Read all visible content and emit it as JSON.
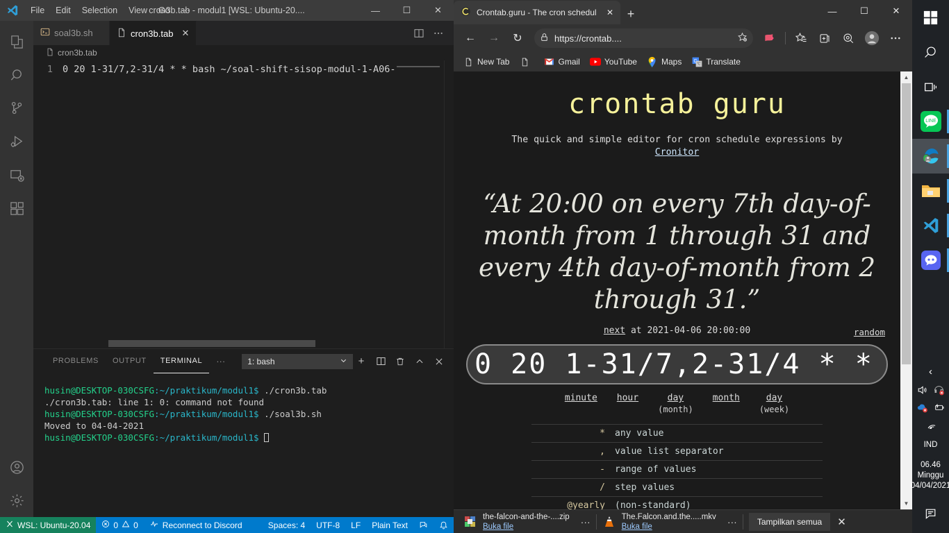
{
  "vscode": {
    "window_title": "cron3b.tab - modul1 [WSL: Ubuntu-20....",
    "menu": [
      "File",
      "Edit",
      "Selection",
      "View",
      "Go",
      "···"
    ],
    "window_controls": {
      "minimize": "—",
      "maximize": "☐",
      "close": "✕"
    },
    "tabs": [
      {
        "label": "soal3b.sh",
        "active": false,
        "icon": "shell-script-icon"
      },
      {
        "label": "cron3b.tab",
        "active": true,
        "icon": "file-icon"
      }
    ],
    "tab_close": "✕",
    "breadcrumb": "cron3b.tab",
    "editor": {
      "line_number": "1",
      "line_text": "0 20 1-31/7,2-31/4 * * bash ~/soal-shift-sisop-modul-1-A06-"
    },
    "panel": {
      "tabs": [
        "PROBLEMS",
        "OUTPUT",
        "TERMINAL"
      ],
      "active_tab": "TERMINAL",
      "more": "···",
      "terminal_select": "1: bash",
      "actions": [
        "new-terminal",
        "split-terminal",
        "kill-terminal",
        "maximize-panel",
        "close-panel"
      ]
    },
    "terminal_lines": [
      {
        "prompt_user": "husin@DESKTOP-030CSFG",
        "prompt_path": ":~/praktikum/modul1$",
        "command": " ./cron3b.tab"
      },
      {
        "output": "./cron3b.tab: line 1: 0: command not found"
      },
      {
        "prompt_user": "husin@DESKTOP-030CSFG",
        "prompt_path": ":~/praktikum/modul1$",
        "command": " ./soal3b.sh"
      },
      {
        "output": "Moved to 04-04-2021"
      },
      {
        "prompt_user": "husin@DESKTOP-030CSFG",
        "prompt_path": ":~/praktikum/modul1$",
        "command": " ",
        "cursor": true
      }
    ],
    "statusbar": {
      "remote": "WSL: Ubuntu-20.04",
      "errors": "0",
      "warnings": "0",
      "discord": "Reconnect to Discord",
      "spaces": "Spaces: 4",
      "encoding": "UTF-8",
      "eol": "LF",
      "language": "Plain Text",
      "feedback_icon": "feedback-icon",
      "bell_icon": "bell-icon"
    },
    "activitybar": [
      "explorer-icon",
      "search-icon",
      "source-control-icon",
      "run-and-debug-icon",
      "remote-explorer-icon",
      "extensions-icon",
      "accounts-icon",
      "settings-gear-icon"
    ]
  },
  "edge": {
    "tab_title": "Crontab.guru - The cron schedul",
    "tab_close": "✕",
    "new_tab": "+",
    "window_controls": {
      "minimize": "—",
      "maximize": "☐",
      "close": "✕"
    },
    "toolbar": {
      "back": "←",
      "forward": "→",
      "reload": "↻",
      "url": "https://crontab....",
      "lock_icon": "lock-icon",
      "favorite_icon": "add-favorite-icon",
      "collections_icon": "collections-icon",
      "favorites_icon": "favorites-icon",
      "browser_essentials_icon": "browser-essentials-icon",
      "profile_icon": "profile-icon",
      "settings_icon": "settings-more-icon"
    },
    "bookmarks": [
      {
        "label": "New Tab",
        "icon": "page-icon"
      },
      {
        "label": "",
        "icon": "page-icon"
      },
      {
        "label": "Gmail",
        "icon": "gmail-icon"
      },
      {
        "label": "YouTube",
        "icon": "youtube-icon"
      },
      {
        "label": "Maps",
        "icon": "maps-icon"
      },
      {
        "label": "Translate",
        "icon": "translate-icon"
      }
    ],
    "downloads": [
      {
        "name": "the-falcon-and-the-....zip",
        "action": "Buka file",
        "icon": "zip-archive-icon",
        "more": "···"
      },
      {
        "name": "The.Falcon.and.the.....mkv",
        "action": "Buka file",
        "icon": "vlc-icon",
        "more": "···"
      }
    ],
    "downloads_show_all": "Tampilkan semua",
    "downloads_close": "✕"
  },
  "crontab_guru": {
    "title": "crontab guru",
    "subtitle_text": "The quick and simple editor for cron schedule expressions by",
    "subtitle_link": "Cronitor",
    "quote": "“At 20:00 on every 7th day-of-month from 1 through 31 and every 4th day-of-month from 2 through 31.”",
    "next_label": "next",
    "next_text": "at 2021-04-06 20:00:00",
    "random_label": "random",
    "expression": "0 20 1-31/7,2-31/4 * *",
    "field_labels": [
      {
        "name": "minute",
        "sub": ""
      },
      {
        "name": "hour",
        "sub": ""
      },
      {
        "name": "day",
        "sub": "(month)"
      },
      {
        "name": "month",
        "sub": ""
      },
      {
        "name": "day",
        "sub": "(week)"
      }
    ],
    "legend": [
      {
        "symbol": "*",
        "description": "any value"
      },
      {
        "symbol": ",",
        "description": "value list separator"
      },
      {
        "symbol": "-",
        "description": "range of values"
      },
      {
        "symbol": "/",
        "description": "step values"
      },
      {
        "symbol": "@yearly",
        "description": "(non-standard)"
      }
    ]
  },
  "taskbar": {
    "items": [
      {
        "name": "start-button",
        "icon": "windows-start-icon"
      },
      {
        "name": "search-button",
        "icon": "search-icon"
      },
      {
        "name": "task-view-button",
        "icon": "task-view-icon"
      },
      {
        "name": "line-app",
        "icon": "line-icon"
      },
      {
        "name": "edge-browser",
        "icon": "edge-icon"
      },
      {
        "name": "file-explorer",
        "icon": "folder-icon"
      },
      {
        "name": "vscode",
        "icon": "vscode-icon"
      },
      {
        "name": "discord",
        "icon": "discord-icon"
      }
    ],
    "tray": {
      "expand": "‹",
      "volume_icon": "volume-icon",
      "headset_muted_icon": "headset-muted-icon",
      "onedrive_error_icon": "onedrive-error-icon",
      "battery_icon": "battery-charging-icon",
      "wifi_icon": "wifi-icon",
      "language": "IND",
      "time": "06.46",
      "day": "Minggu",
      "date": "04/04/2021",
      "notifications_icon": "notifications-icon"
    }
  }
}
